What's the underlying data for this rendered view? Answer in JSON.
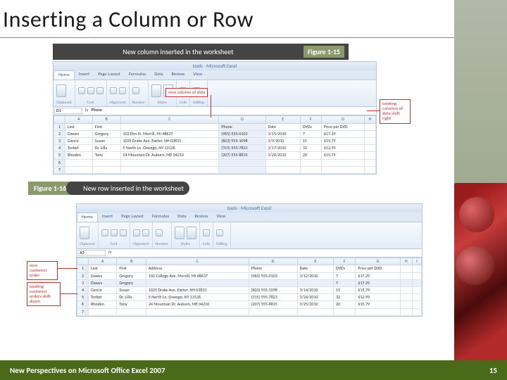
{
  "slide": {
    "title": "Inserting a Column or Row",
    "footer_note": "New Perspectives on Microsoft Office Excel 2007",
    "page_number": "15"
  },
  "figure1": {
    "number": "Figure 1-15",
    "caption": "New column inserted in the worksheet",
    "window_title": "tools - Microsoft Excel",
    "callout_newcol": "new column of data",
    "callout_shift": "existing columns of data shift right",
    "ribbon_tabs": [
      "Home",
      "Insert",
      "Page Layout",
      "Formulas",
      "Data",
      "Review",
      "View"
    ],
    "ribbon_groups": [
      "Clipboard",
      "Font",
      "Alignment",
      "Number",
      "Styles",
      "Cells",
      "Editing"
    ],
    "namebox": "D1",
    "col_headers": [
      "",
      "A",
      "B",
      "C",
      "D",
      "E",
      "F",
      "G",
      "H"
    ],
    "new_col_label": "Phone",
    "rows": [
      {
        "n": "1",
        "c": [
          "Last",
          "First",
          "",
          "Phone",
          "Date",
          "DVDs",
          "Price per DVD",
          ""
        ]
      },
      {
        "n": "2",
        "c": [
          "Dawes",
          "Gregory",
          "102 Elm St.  Merrill, MI 48637",
          "(965) 555-0103",
          "3/15/2010",
          "7",
          "$17.29",
          ""
        ]
      },
      {
        "n": "3",
        "c": [
          "Garcia",
          "Susan",
          "1025 Drake Ave.  Exeter, NH 03833",
          "(603) 555-1098",
          "3/9/2010",
          "15",
          "$15.79",
          ""
        ]
      },
      {
        "n": "4",
        "c": [
          "Torbet",
          "Dr. Lilla",
          "5 North Ln.  Oswego, NY 13126",
          "(315) 555-7823",
          "3/17/2010",
          "32",
          "$12.99",
          ""
        ]
      },
      {
        "n": "5",
        "c": [
          "Rhoden",
          "Tony",
          "24 Mountain Dr.  Auburn, ME 04210",
          "(207) 555-8815",
          "3/20/2010",
          "20",
          "$15.79",
          ""
        ]
      },
      {
        "n": "6",
        "c": [
          "",
          "",
          "",
          "",
          "",
          "",
          "",
          ""
        ]
      },
      {
        "n": "7",
        "c": [
          "",
          "",
          "",
          "",
          "",
          "",
          "",
          ""
        ]
      }
    ]
  },
  "figure2": {
    "number": "Figure 1-16",
    "caption": "New row inserted in the worksheet",
    "window_title": "tools - Microsoft Excel",
    "callout_newrow": "new customer order",
    "callout_shift": "existing customer orders shift down",
    "ribbon_tabs": [
      "Home",
      "Insert",
      "Page Layout",
      "Formulas",
      "Data",
      "Review",
      "View"
    ],
    "ribbon_groups": [
      "Clipboard",
      "Font",
      "Alignment",
      "Number",
      "Styles",
      "Cells",
      "Editing"
    ],
    "namebox": "A3",
    "col_headers": [
      "",
      "A",
      "B",
      "C",
      "D",
      "E",
      "F",
      "G",
      "H",
      "I"
    ],
    "rows": [
      {
        "n": "1",
        "c": [
          "Last",
          "First",
          "Address",
          "Phone",
          "Date",
          "DVDs",
          "Price per DVD",
          "",
          ""
        ]
      },
      {
        "n": "2",
        "c": [
          "Dawes",
          "Gregory",
          "102 College Ave.  Merrill, MI 48637",
          "(965) 555-0103",
          "3/12/2010",
          "7",
          "$17.29",
          "",
          ""
        ]
      },
      {
        "n": "3",
        "c": [
          "Dawes",
          "Gregory",
          "",
          "",
          "",
          "7",
          "$17.29",
          "",
          ""
        ]
      },
      {
        "n": "4",
        "c": [
          "Garcia",
          "Susan",
          "1025 Drake Ave.  Exeter, NH 03833",
          "(603) 555-1098",
          "3/14/2010",
          "15",
          "$15.79",
          "",
          ""
        ]
      },
      {
        "n": "5",
        "c": [
          "Torbet",
          "Dr. Lilla",
          "5 North Ln.  Oswego, NY 13126",
          "(315) 555-7823",
          "3/24/2010",
          "32",
          "$12.99",
          "",
          ""
        ]
      },
      {
        "n": "6",
        "c": [
          "Rhoden",
          "Tony",
          "24 Mountain Dr.  Auburn, ME 04210",
          "(207) 555-8815",
          "3/25/2010",
          "20",
          "$15.79",
          "",
          ""
        ]
      },
      {
        "n": "7",
        "c": [
          "",
          "",
          "",
          "",
          "",
          "",
          "",
          "",
          ""
        ]
      }
    ]
  }
}
